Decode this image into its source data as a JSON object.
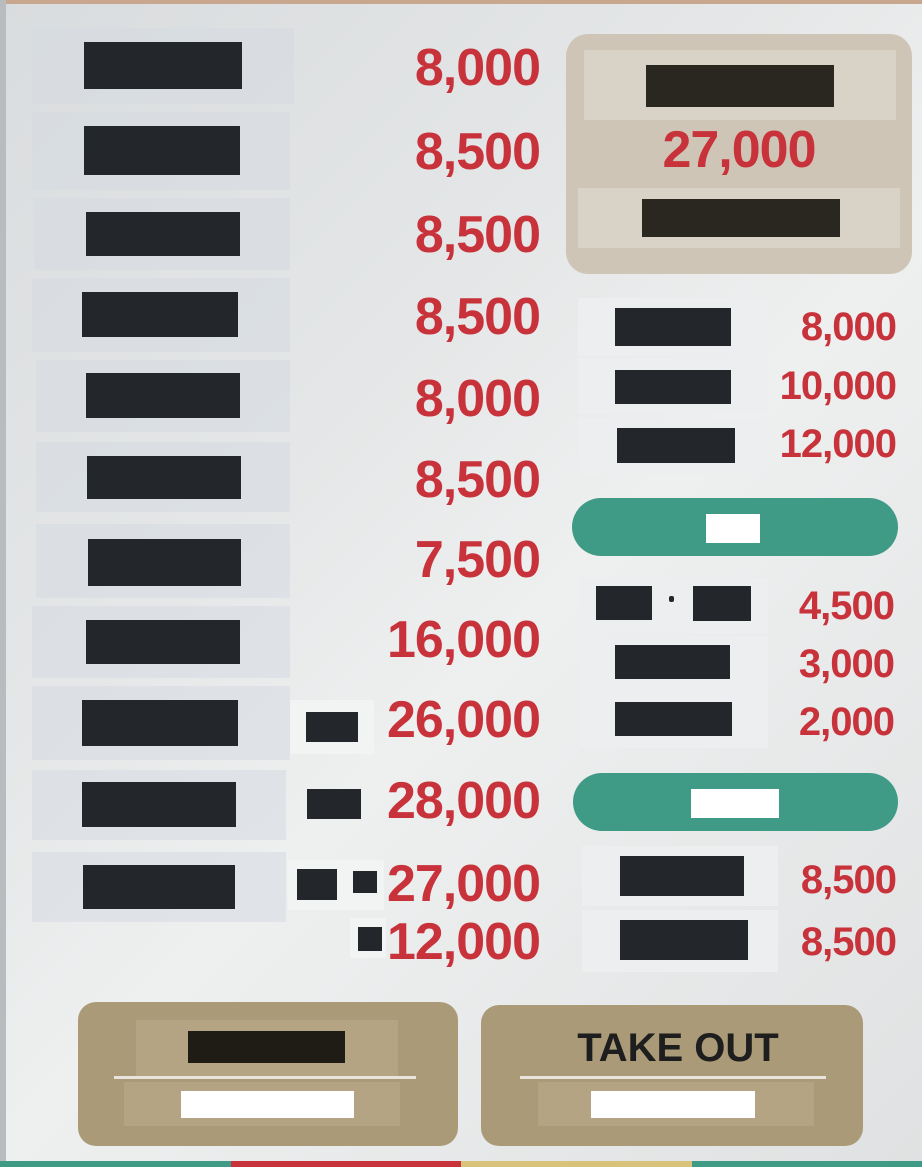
{
  "colors": {
    "price": "#c8323a",
    "pill": "#3f9a86",
    "button": "#ab9a78",
    "feature_box": "#cfc5b6",
    "redaction": "#23272b"
  },
  "left_menu": [
    {
      "price": "8,000"
    },
    {
      "price": "8,500"
    },
    {
      "price": "8,500"
    },
    {
      "price": "8,500"
    },
    {
      "price": "8,000"
    },
    {
      "price": "8,500"
    },
    {
      "price": "7,500"
    },
    {
      "price": "16,000"
    },
    {
      "price": "26,000"
    },
    {
      "price": "28,000"
    },
    {
      "price": "27,000"
    },
    {
      "price": "12,000"
    }
  ],
  "feature": {
    "price": "27,000"
  },
  "right_menu_a": [
    {
      "price": "8,000"
    },
    {
      "price": "10,000"
    },
    {
      "price": "12,000"
    }
  ],
  "right_menu_b": [
    {
      "price": "4,500"
    },
    {
      "price": "3,000"
    },
    {
      "price": "2,000"
    }
  ],
  "right_menu_c": [
    {
      "price": "8,500"
    },
    {
      "price": "8,500"
    }
  ],
  "buttons": {
    "takeout_label": "TAKE OUT"
  }
}
